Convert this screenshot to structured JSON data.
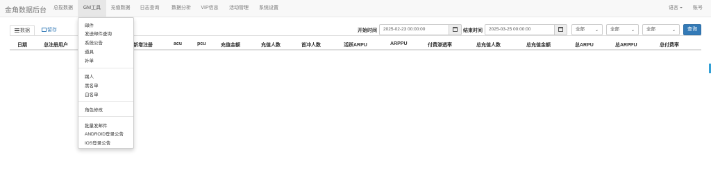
{
  "navbar": {
    "brand": "金角数据后台",
    "items": [
      {
        "label": "总揽数据"
      },
      {
        "label": "GM工具"
      },
      {
        "label": "充值数据"
      },
      {
        "label": "日志查询"
      },
      {
        "label": "数据分析"
      },
      {
        "label": "VIP信息"
      },
      {
        "label": "活动管理"
      },
      {
        "label": "系统设置"
      }
    ],
    "active_item": "GM工具",
    "language_label": "语言",
    "account_label": "账号"
  },
  "tabs": [
    {
      "label": "数据",
      "icon": "list-icon",
      "active": true
    },
    {
      "label": "留存",
      "icon": "table-icon",
      "active": false
    }
  ],
  "filters": {
    "start_label": "开始时间",
    "start_value": "2025-02-23 00:00:00",
    "end_label": "结束时间",
    "end_value": "2025-03-25 00:00:00",
    "selects": [
      {
        "value": "全部"
      },
      {
        "value": "全部"
      },
      {
        "value": "全部"
      }
    ],
    "query_label": "查询"
  },
  "table": {
    "headers": [
      "日期",
      "总注册用户",
      "",
      "新增注册",
      "acu",
      "pcu",
      "充值金额",
      "充值人数",
      "首冲人数",
      "活跃ARPU",
      "ARPPU",
      "付费渗透率",
      "总充值人数",
      "总充值金额",
      "总ARPU",
      "总ARPPU",
      "总付费率"
    ],
    "rows": []
  },
  "dropdown": {
    "groups": [
      [
        "邮件",
        "发送邮件查询",
        "系统公告",
        "道具",
        "补单"
      ],
      [
        "踢人",
        "黑名单",
        "白名单"
      ],
      [
        "角色修改"
      ],
      [
        "批量发邮件",
        "ANDROID登录公告",
        "IOS登录公告"
      ]
    ]
  },
  "colors": {
    "primary": "#337ab7",
    "navbar_bg": "#f8f8f8",
    "active_nav_bg": "#e7e7e7",
    "accent_edge": "#33a0d6"
  }
}
